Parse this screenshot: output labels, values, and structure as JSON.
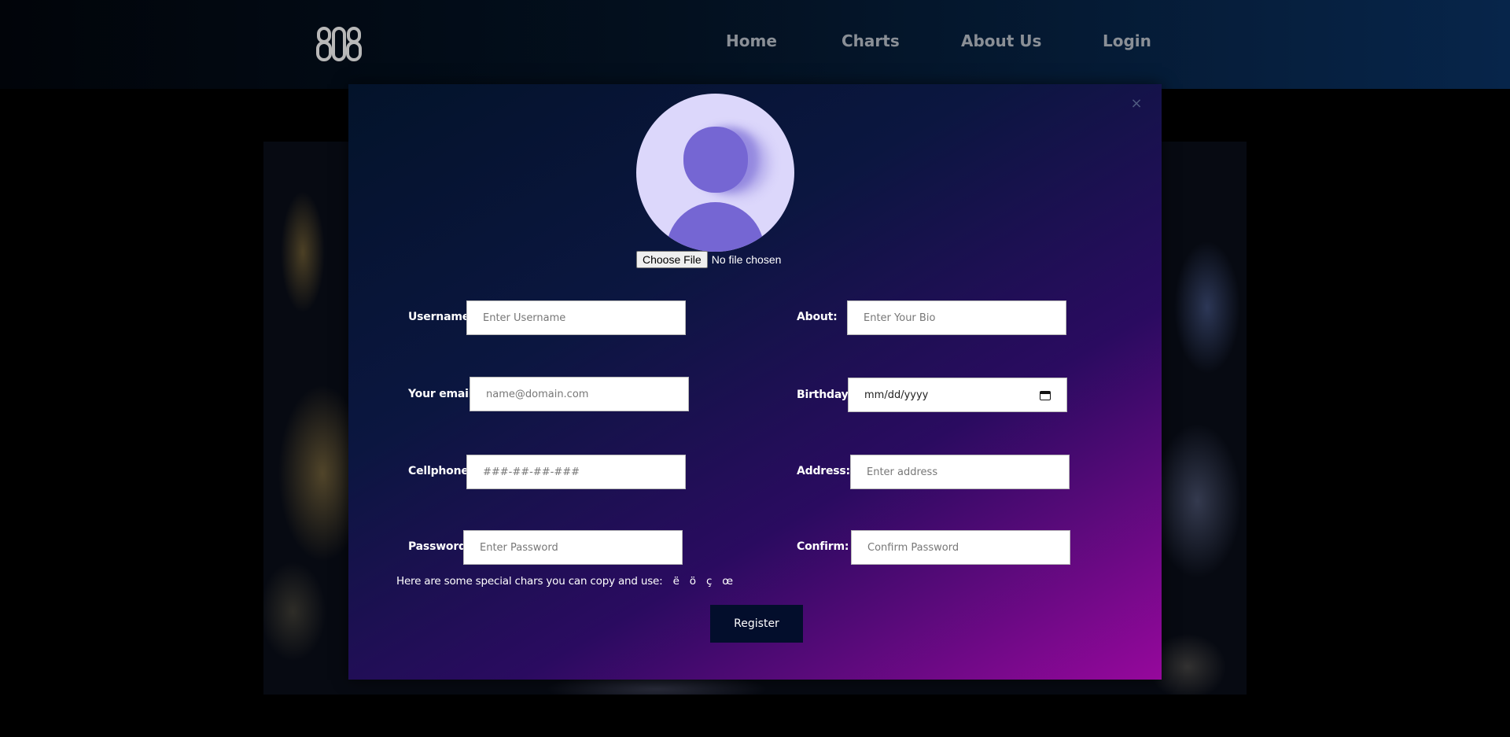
{
  "header": {
    "logo": "808",
    "nav": [
      {
        "label": "Home"
      },
      {
        "label": "Charts"
      },
      {
        "label": "About Us"
      },
      {
        "label": "Login"
      }
    ]
  },
  "modal": {
    "close": "×",
    "file": {
      "button": "Choose File",
      "status": "No file chosen"
    },
    "fields": {
      "username": {
        "label": "Username:",
        "placeholder": "Enter Username"
      },
      "email": {
        "label": "Your email:",
        "placeholder": "name@domain.com"
      },
      "cellphone": {
        "label": "Cellphone:",
        "placeholder": "###-##-##-###"
      },
      "password": {
        "label": "Password:",
        "placeholder": "Enter Password"
      },
      "about": {
        "label": "About:",
        "placeholder": "Enter Your Bio"
      },
      "birthday": {
        "label": "Birthday:",
        "value": "mm/dd/yyyy"
      },
      "address": {
        "label": "Address:",
        "placeholder": "Enter address"
      },
      "confirm": {
        "label": "Confirm:",
        "placeholder": "Confirm Password"
      }
    },
    "special": {
      "text": "Here are some special chars you can copy and use:",
      "chars": [
        "ë",
        "ö",
        "ç",
        "œ"
      ]
    },
    "register": "Register"
  }
}
